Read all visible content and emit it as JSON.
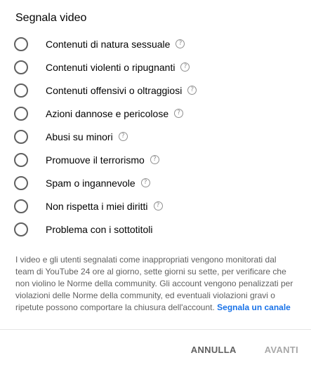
{
  "dialog": {
    "title": "Segnala video",
    "options": [
      {
        "label": "Contenuti di natura sessuale",
        "help": true
      },
      {
        "label": "Contenuti violenti o ripugnanti",
        "help": true
      },
      {
        "label": "Contenuti offensivi o oltraggiosi",
        "help": true
      },
      {
        "label": "Azioni dannose e pericolose",
        "help": true
      },
      {
        "label": "Abusi su minori",
        "help": true
      },
      {
        "label": "Promuove il terrorismo",
        "help": true
      },
      {
        "label": "Spam o ingannevole",
        "help": true
      },
      {
        "label": "Non rispetta i miei diritti",
        "help": true
      },
      {
        "label": "Problema con i sottotitoli",
        "help": false
      }
    ],
    "help_glyph": "?",
    "disclaimer_text": "I video e gli utenti segnalati come inappropriati vengono monitorati dal team di YouTube 24 ore al giorno, sette giorni su sette, per verificare che non violino le Norme della community. Gli account vengono penalizzati per violazioni delle Norme della community, ed eventuali violazioni gravi o ripetute possono comportare la chiusura dell'account.",
    "disclaimer_link": "Segnala un canale",
    "cancel_label": "ANNULLA",
    "next_label": "AVANTI"
  },
  "colors": {
    "link": "#1a73e8",
    "radio_border": "#606060",
    "disabled_button": "#a8a8a8"
  },
  "icons": {
    "radio": "radio-unchecked-icon",
    "help": "help-circle-icon"
  }
}
